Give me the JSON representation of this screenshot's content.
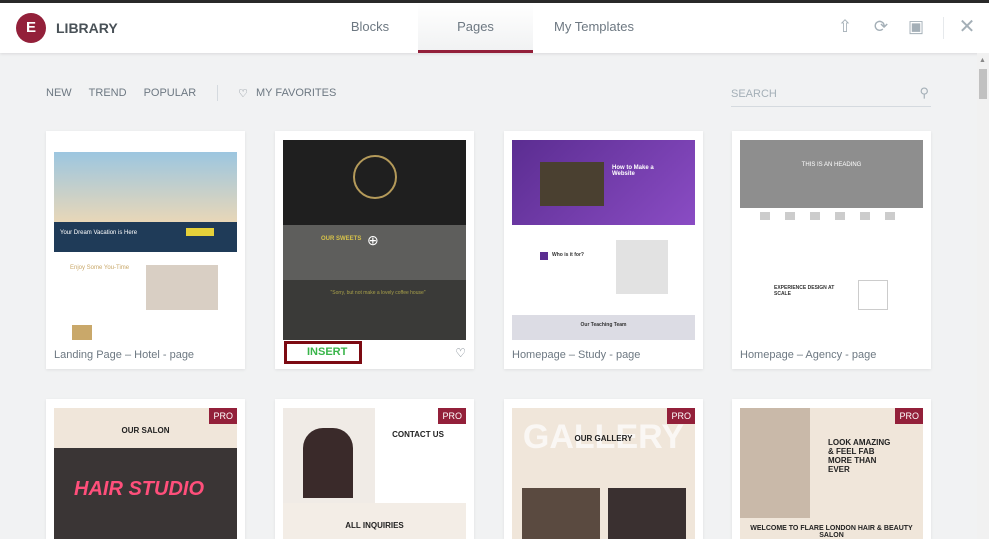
{
  "header": {
    "logo": "E",
    "title": "LIBRARY",
    "tabs": [
      {
        "label": "Blocks"
      },
      {
        "label": "Pages",
        "active": true
      },
      {
        "label": "My Templates"
      }
    ],
    "icons": [
      "upload-icon",
      "sync-icon",
      "save-icon",
      "close-icon"
    ]
  },
  "filters": {
    "items": [
      "NEW",
      "TREND",
      "POPULAR"
    ],
    "favorites": "MY FAVORITES",
    "search_placeholder": "SEARCH"
  },
  "colors": {
    "accent": "#93203a",
    "insert": "#39b54a"
  },
  "cards": [
    {
      "name": "Landing Page – Hotel - page",
      "thumb_text": "Your Dream Vacation is Here",
      "thumb_text2": "Enjoy Some You-Time"
    },
    {
      "name": "",
      "insert": "INSERT",
      "thumb_text": "OUR SWEETS",
      "thumb_text2": "\"Sorry, but not make a lovely coffee house\""
    },
    {
      "name": "Homepage – Study - page",
      "thumb_text": "How to Make a Website",
      "thumb_text2": "Who is it for?",
      "thumb_text3": "Our Teaching Team"
    },
    {
      "name": "Homepage – Agency - page",
      "thumb_text": "THIS IS AN HEADING",
      "thumb_text2": "EXPERIENCE DESIGN AT SCALE"
    },
    {
      "pro": "PRO",
      "thumb_text": "OUR SALON",
      "thumb_text2": "HAIR STUDIO"
    },
    {
      "pro": "PRO",
      "thumb_text": "CONTACT US",
      "thumb_text2": "ALL INQUIRIES"
    },
    {
      "pro": "PRO",
      "thumb_text": "OUR GALLERY",
      "thumb_text2": "GALLERY"
    },
    {
      "pro": "PRO",
      "thumb_text": "LOOK AMAZING & FEEL FAB MORE THAN EVER",
      "thumb_text2": "WELCOME TO FLARE LONDON HAIR & BEAUTY SALON"
    }
  ]
}
